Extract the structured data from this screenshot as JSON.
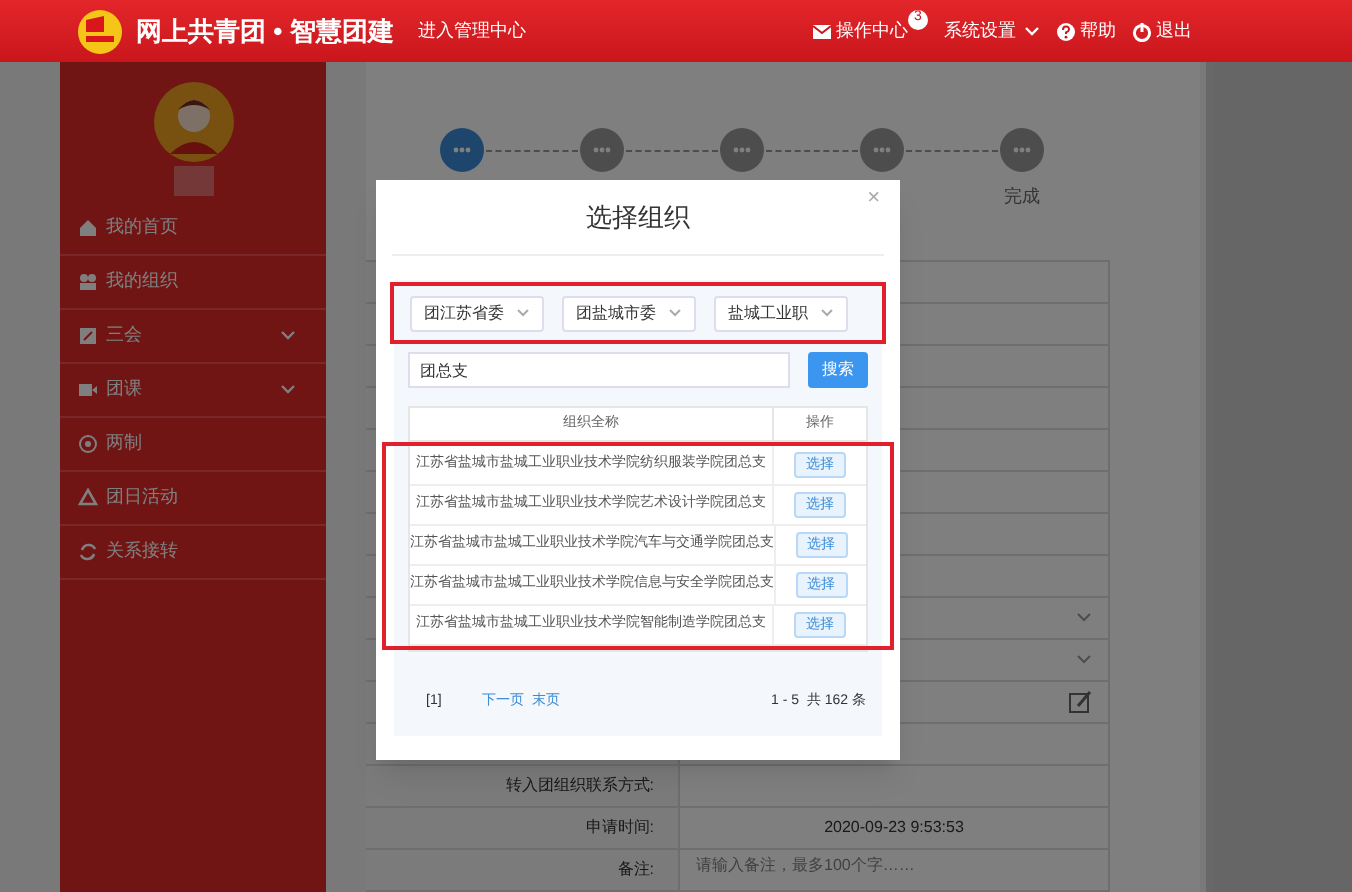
{
  "header": {
    "title": "网上共青团 • 智慧团建",
    "admin_link": "进入管理中心",
    "actions": [
      {
        "kind": "mail",
        "label": "操作中心",
        "badge": "3"
      },
      {
        "kind": "settings",
        "label": "系统设置"
      },
      {
        "kind": "help",
        "label": "帮助"
      },
      {
        "kind": "logout",
        "label": "退出"
      }
    ]
  },
  "sidebar": {
    "items": [
      {
        "kind": "home",
        "label": "我的首页",
        "expandable": false
      },
      {
        "kind": "group",
        "label": "我的组织",
        "expandable": false
      },
      {
        "kind": "edit",
        "label": "三会",
        "expandable": true
      },
      {
        "kind": "video",
        "label": "团课",
        "expandable": true
      },
      {
        "kind": "target",
        "label": "两制",
        "expandable": false
      },
      {
        "kind": "recycle",
        "label": "团日活动",
        "expandable": false
      },
      {
        "kind": "refresh",
        "label": "关系接转",
        "expandable": false
      }
    ]
  },
  "steps": [
    {
      "active": true
    },
    {
      "active": false
    },
    {
      "active": false
    },
    {
      "active": false
    },
    {
      "active": false,
      "label": "完成"
    }
  ],
  "form_rows": [
    {
      "kind": "plain"
    },
    {
      "kind": "plain"
    },
    {
      "kind": "plain"
    },
    {
      "kind": "plain"
    },
    {
      "kind": "plain"
    },
    {
      "kind": "plain"
    },
    {
      "kind": "plain"
    },
    {
      "kind": "plain"
    },
    {
      "kind": "select"
    },
    {
      "kind": "select"
    },
    {
      "kind": "edit"
    },
    {
      "kind": "plain"
    },
    {
      "kind": "plain",
      "label": "转入团组织联系方式:"
    },
    {
      "kind": "plain",
      "label": "申请时间:",
      "value": "2020-09-23 9:53:53"
    },
    {
      "kind": "textarea",
      "label": "备注:",
      "placeholder": "请输入备注，最多100个字……"
    }
  ],
  "dialog": {
    "title": "选择组织",
    "close": "×",
    "selects": [
      "团江苏省委",
      "团盐城市委",
      "盐城工业职"
    ],
    "search": {
      "value": "团总支",
      "button": "搜索"
    },
    "table": {
      "columns": [
        "组织全称",
        "操作"
      ],
      "rows": [
        {
          "name": "江苏省盐城市盐城工业职业技术学院纺织服装学院团总支",
          "action": "选择"
        },
        {
          "name": "江苏省盐城市盐城工业职业技术学院艺术设计学院团总支",
          "action": "选择"
        },
        {
          "name": "江苏省盐城市盐城工业职业技术学院汽车与交通学院团总支",
          "action": "选择"
        },
        {
          "name": "江苏省盐城市盐城工业职业技术学院信息与安全学院团总支",
          "action": "选择"
        },
        {
          "name": "江苏省盐城市盐城工业职业技术学院智能制造学院团总支",
          "action": "选择"
        }
      ]
    },
    "pagination": {
      "current": "[1]",
      "next": "下一页",
      "last": "末页",
      "summary": "1 - 5  共 162 条"
    }
  }
}
